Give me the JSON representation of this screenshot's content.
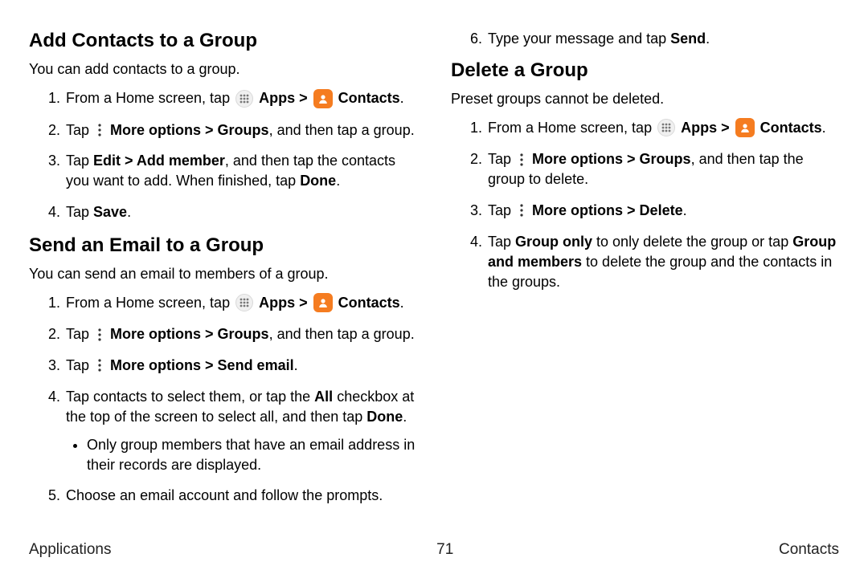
{
  "left": {
    "sec1": {
      "heading": "Add Contacts to a Group",
      "lead": "You can add contacts to a group.",
      "li1_a": "From a Home screen, tap ",
      "li1_apps": "Apps",
      "li1_chev": " > ",
      "li1_contacts": "Contacts",
      "li1_end": ".",
      "li2_a": "Tap ",
      "li2_b": "More options > Groups",
      "li2_c": ", and then tap a group.",
      "li3_a": "Tap ",
      "li3_b": "Edit > Add member",
      "li3_c": ", and then tap the contacts you want to add. When finished, tap ",
      "li3_d": "Done",
      "li3_e": ".",
      "li4_a": "Tap ",
      "li4_b": "Save",
      "li4_c": "."
    },
    "sec2": {
      "heading": "Send an Email to a Group",
      "lead": "You can send an email to members of a group.",
      "li1_a": "From a Home screen, tap ",
      "li1_apps": "Apps",
      "li1_chev": " > ",
      "li1_contacts": "Contacts",
      "li1_end": ".",
      "li2_a": "Tap ",
      "li2_b": "More options > Groups",
      "li2_c": ", and then tap a group.",
      "li3_a": "Tap ",
      "li3_b": "More options > Send email",
      "li3_c": ".",
      "li4_a": "Tap contacts to select them, or tap the ",
      "li4_b": "All",
      "li4_c": " checkbox at the top of the screen to select all, and then tap ",
      "li4_d": "Done",
      "li4_e": ".",
      "li4_sub": "Only group members that have an email address in their records are displayed.",
      "li5": "Choose an email account and follow the prompts.",
      "li6_a": "Type your message and tap ",
      "li6_b": "Send",
      "li6_c": "."
    }
  },
  "right": {
    "sec3": {
      "heading": "Delete a Group",
      "lead": "Preset groups cannot be deleted.",
      "li1_a": "From a Home screen, tap ",
      "li1_apps": "Apps",
      "li1_chev": " > ",
      "li1_contacts": "Contacts",
      "li1_end": ".",
      "li2_a": "Tap ",
      "li2_b": "More options > Groups",
      "li2_c": ", and then tap the group to delete.",
      "li3_a": "Tap ",
      "li3_b": "More options > Delete",
      "li3_c": ".",
      "li4_a": "Tap ",
      "li4_b": "Group only",
      "li4_c": " to only delete the group or tap ",
      "li4_d": "Group and members",
      "li4_e": " to delete the group and the contacts in the groups."
    }
  },
  "footer": {
    "left": "Applications",
    "center": "71",
    "right": "Contacts"
  }
}
